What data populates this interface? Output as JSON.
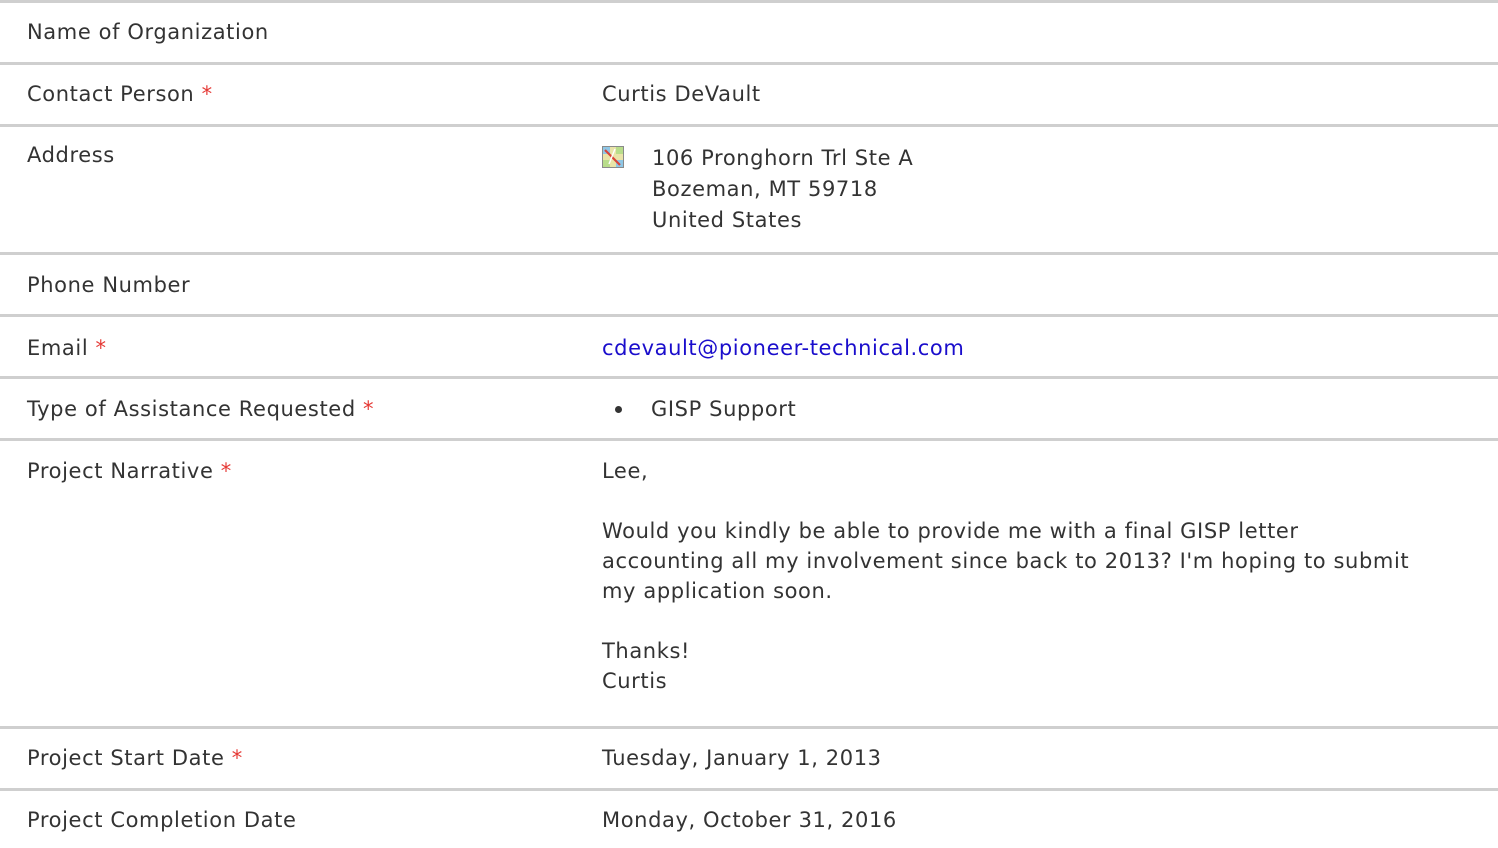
{
  "fields": {
    "organization": {
      "label": "Name of Organization",
      "value": ""
    },
    "contact": {
      "label": "Contact Person",
      "required_mark": "*",
      "value": "Curtis DeVault"
    },
    "address": {
      "label": "Address",
      "icon": "map-icon",
      "line1": "106 Pronghorn Trl Ste A",
      "line2": "Bozeman, MT 59718",
      "line3": "United States"
    },
    "phone": {
      "label": "Phone Number",
      "value": ""
    },
    "email": {
      "label": "Email",
      "required_mark": "*",
      "value": "cdevault@pioneer-technical.com"
    },
    "assistance": {
      "label": "Type of Assistance Requested",
      "required_mark": "*",
      "items": [
        "GISP Support"
      ]
    },
    "narrative": {
      "label": "Project Narrative",
      "required_mark": "*",
      "greeting": "Lee,",
      "body_line1": "Would you kindly be able to provide me with a final GISP letter",
      "body_line2": "accounting all my involvement since back to 2013? I'm hoping to submit",
      "body_line3": "my application soon.",
      "closing": "Thanks!",
      "signature": "Curtis"
    },
    "start_date": {
      "label": "Project Start Date",
      "required_mark": "*",
      "value": "Tuesday, January 1, 2013"
    },
    "completion_date": {
      "label": "Project Completion Date",
      "value": "Monday, October 31, 2016"
    }
  },
  "colors": {
    "required": "#e53935",
    "link": "#1a0dcc",
    "divider": "#cfcfcf",
    "text": "#333333"
  }
}
